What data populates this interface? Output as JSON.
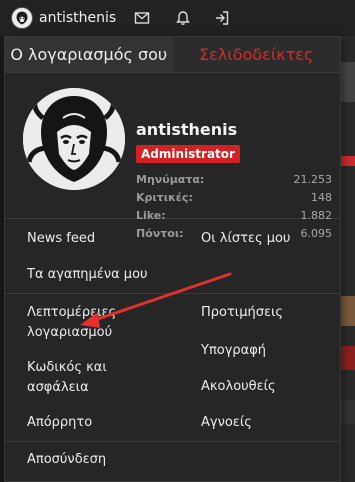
{
  "topbar": {
    "username": "antisthenis",
    "icons": [
      "mail-icon",
      "bell-icon",
      "logout-icon"
    ]
  },
  "tabs": [
    {
      "label": "Ο λογαριασμός σου",
      "active": true
    },
    {
      "label": "Σελιδοδείκτες",
      "active": false
    }
  ],
  "profile": {
    "name": "antisthenis",
    "role": "Administrator",
    "stats": [
      {
        "label": "Μηνύματα:",
        "value": "21.253"
      },
      {
        "label": "Κριτικές:",
        "value": "148"
      },
      {
        "label": "Like:",
        "value": "1.882"
      },
      {
        "label": "Πόντοι:",
        "value": "6.095"
      }
    ]
  },
  "menu": {
    "news_feed": "News feed",
    "my_lists": "Οι λίστες μου",
    "favorites": "Τα αγαπημένα μου",
    "account_details_line1": "Λεπτομέρειες",
    "account_details_line2": "λογαριασμού",
    "preferences": "Προτιμήσεις",
    "signature": "Υπογραφή",
    "password_line1": "Κωδικός και",
    "password_line2": "ασφάλεια",
    "following": "Ακολουθείς",
    "privacy": "Απόρρητο",
    "ignoring": "Αγνοείς",
    "logout": "Αποσύνδεση"
  },
  "colors": {
    "accent_red": "#d22b2b",
    "badge_red": "#d32124",
    "panel_bg": "#262626",
    "arrow": "#e0312e"
  }
}
